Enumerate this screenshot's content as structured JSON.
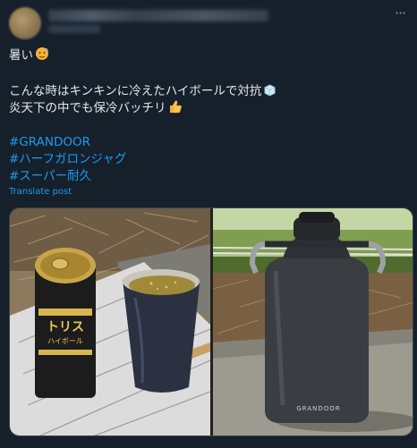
{
  "post": {
    "lines": {
      "l1": "暑い",
      "l2": "こんな時はキンキンに冷えたハイボールで対抗",
      "l3": "炎天下の中でも保冷バッチリ"
    },
    "hashtags": [
      "#GRANDOOR",
      "#ハーフガロンジャグ",
      "#スーパー耐久"
    ],
    "translate_label": "Translate post",
    "more_label": "···",
    "emojis": {
      "hot": "hot-face",
      "ice": "ice-cube",
      "thumb": "thumbs-up"
    }
  },
  "media": {
    "can_brand": "トリス",
    "can_sub": "ハイボール",
    "jug_brand": "GRANDOOR"
  }
}
